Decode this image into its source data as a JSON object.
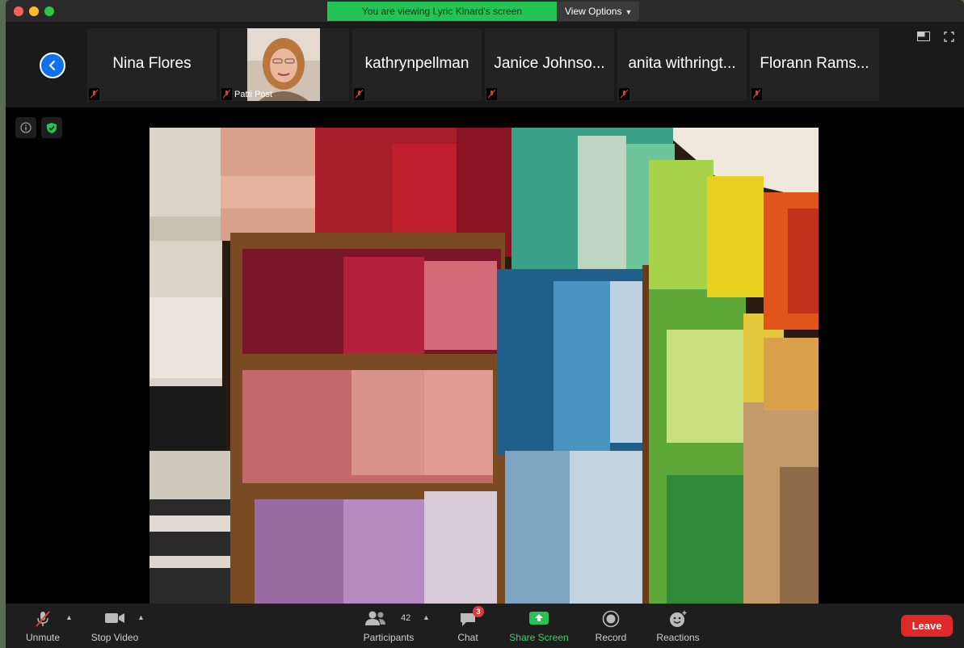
{
  "banner": {
    "text": "You are viewing Lyric Kinard's screen",
    "view_options": "View Options"
  },
  "participants_strip": [
    {
      "name": "Nina Flores"
    },
    {
      "name": "Patti Post"
    },
    {
      "name": "kathrynpellman"
    },
    {
      "name": "Janice Johnso..."
    },
    {
      "name": "anita withringt..."
    },
    {
      "name": "Florann Rams..."
    }
  ],
  "toolbar": {
    "unmute": "Unmute",
    "stop_video": "Stop Video",
    "participants": "Participants",
    "participants_count": "42",
    "chat": "Chat",
    "chat_badge": "3",
    "share_screen": "Share Screen",
    "record": "Record",
    "reactions": "Reactions",
    "leave": "Leave"
  },
  "colors": {
    "banner_green": "#23c453",
    "accent_blue": "#0e72ed",
    "leave_red": "#e02828",
    "share_green": "#3bd16f"
  },
  "icons": [
    "back-icon",
    "mic-muted-icon",
    "info-icon",
    "shield-icon",
    "view-layout-icon",
    "fullscreen-icon",
    "microphone-icon",
    "video-camera-icon",
    "participants-icon",
    "chat-icon",
    "share-screen-icon",
    "record-icon",
    "reactions-icon"
  ]
}
